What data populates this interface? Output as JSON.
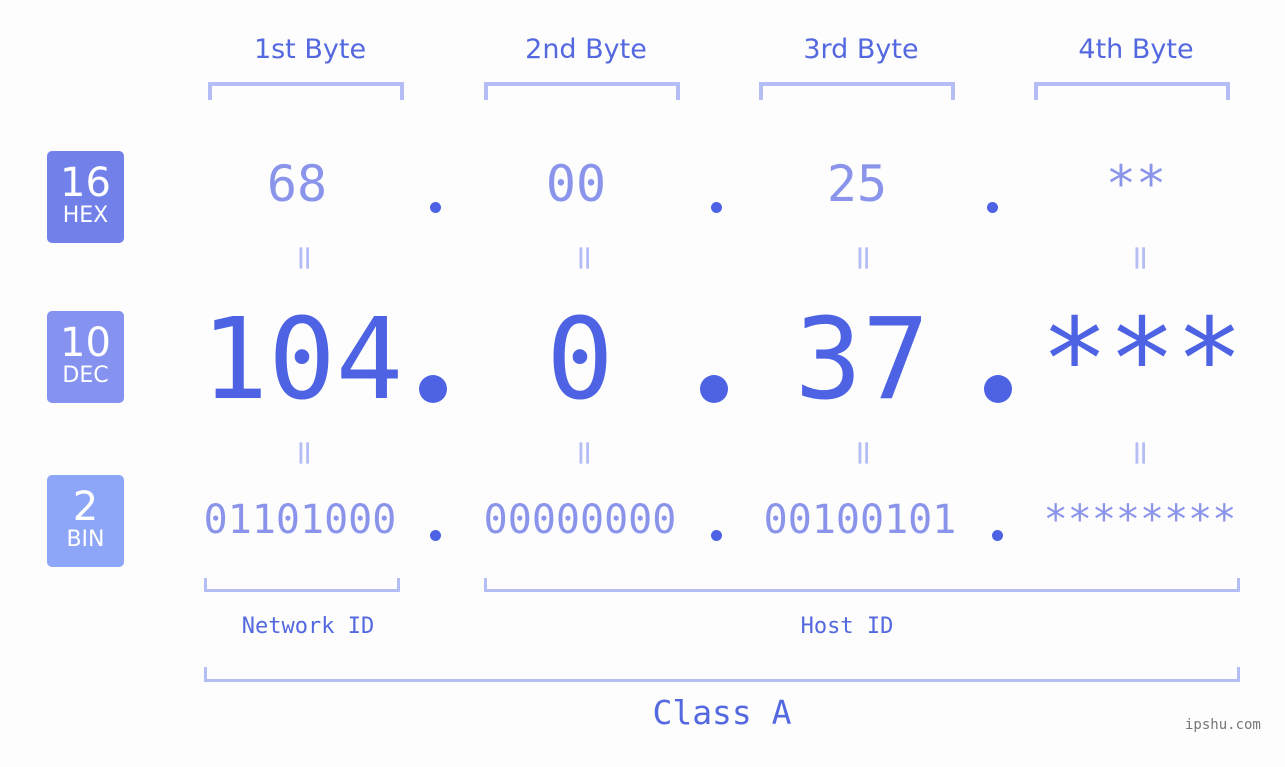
{
  "badges": [
    {
      "num": "16",
      "label": "HEX",
      "color": "#7281e9"
    },
    {
      "num": "10",
      "label": "DEC",
      "color": "#8592f0"
    },
    {
      "num": "2",
      "label": "BIN",
      "color": "#8ea6f8"
    }
  ],
  "bytes": [
    {
      "header": "1st Byte",
      "hex": "68",
      "dec": "104",
      "bin": "01101000"
    },
    {
      "header": "2nd Byte",
      "hex": "00",
      "dec": "0",
      "bin": "00000000"
    },
    {
      "header": "3rd Byte",
      "hex": "25",
      "dec": "37",
      "bin": "00100101"
    },
    {
      "header": "4th Byte",
      "hex": "**",
      "dec": "***",
      "bin": "********"
    }
  ],
  "equals": "=",
  "network_label": "Network ID",
  "host_label": "Host ID",
  "class_label": "Class A",
  "watermark": "ipshu.com",
  "colors": {
    "primary": "#4e63e4",
    "light": "#8a94ea",
    "bracket": "#b4bdf5"
  }
}
